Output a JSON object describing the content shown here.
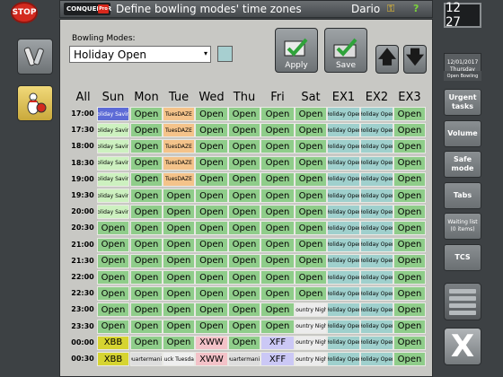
{
  "stop_button": "STOP",
  "titlebar": {
    "logo": "CONQUEROR",
    "logo_badge": "Pro",
    "title": "Define bowling modes' time zones",
    "user": "Dario",
    "key_icon": "key-icon",
    "help_icon": "?"
  },
  "form": {
    "bowling_modes_label": "Bowling Modes:",
    "bowling_mode_value": "Holiday Open",
    "swatch_color": "#a7cfd0"
  },
  "toolbar": {
    "apply_label": "Apply",
    "save_label": "Save"
  },
  "grid": {
    "headers": [
      "All",
      "Sun",
      "Mon",
      "Tue",
      "Wed",
      "Thu",
      "Fri",
      "Sat",
      "EX1",
      "EX2",
      "EX3"
    ],
    "times": [
      "17:00",
      "17:30",
      "18:00",
      "18:30",
      "19:00",
      "19:30",
      "20:00",
      "20:30",
      "21:00",
      "21:30",
      "22:00",
      "22:30",
      "23:00",
      "23:30",
      "00:00",
      "00:30"
    ],
    "colors": {
      "o": "#8fcd8a",
      "hs": "#cdf1c0",
      "hs_sel": "#5d6bd6",
      "ho": "#9fd0cd",
      "t": "#f4c38a",
      "c": "#ececec",
      "q": "#dedede",
      "xbb": "#d6d431",
      "xww": "#f3c2c8",
      "xff": "#cbc8f5",
      "b": "#efefef"
    },
    "labels": {
      "o": "Open",
      "hs": "Holiday Saving",
      "ho": "Holiday Open",
      "t": "TuesDAZE",
      "c": "Country Night",
      "q": "Quartermania",
      "b": "Buck Tuesday",
      "xbb": "XBB",
      "xww": "XWW",
      "xff": "XFF"
    },
    "rows": [
      [
        "hs_sel",
        "o",
        "t",
        "o",
        "o",
        "o",
        "o",
        "ho",
        "ho",
        "o"
      ],
      [
        "hs",
        "o",
        "t",
        "o",
        "o",
        "o",
        "o",
        "ho",
        "ho",
        "o"
      ],
      [
        "hs",
        "o",
        "t",
        "o",
        "o",
        "o",
        "o",
        "ho",
        "ho",
        "o"
      ],
      [
        "hs",
        "o",
        "t",
        "o",
        "o",
        "o",
        "o",
        "ho",
        "ho",
        "o"
      ],
      [
        "hs",
        "o",
        "t",
        "o",
        "o",
        "o",
        "o",
        "ho",
        "ho",
        "o"
      ],
      [
        "hs",
        "o",
        "o",
        "o",
        "o",
        "o",
        "o",
        "ho",
        "ho",
        "o"
      ],
      [
        "hs",
        "o",
        "o",
        "o",
        "o",
        "o",
        "o",
        "ho",
        "ho",
        "o"
      ],
      [
        "o",
        "o",
        "o",
        "o",
        "o",
        "o",
        "o",
        "ho",
        "ho",
        "o"
      ],
      [
        "o",
        "o",
        "o",
        "o",
        "o",
        "o",
        "o",
        "ho",
        "ho",
        "o"
      ],
      [
        "o",
        "o",
        "o",
        "o",
        "o",
        "o",
        "o",
        "ho",
        "ho",
        "o"
      ],
      [
        "o",
        "o",
        "o",
        "o",
        "o",
        "o",
        "o",
        "ho",
        "ho",
        "o"
      ],
      [
        "o",
        "o",
        "o",
        "o",
        "o",
        "o",
        "o",
        "ho",
        "ho",
        "o"
      ],
      [
        "o",
        "o",
        "o",
        "o",
        "o",
        "o",
        "c",
        "ho",
        "ho",
        "o"
      ],
      [
        "o",
        "o",
        "o",
        "o",
        "o",
        "o",
        "c",
        "ho",
        "ho",
        "o"
      ],
      [
        "xbb",
        "o",
        "o",
        "xww",
        "o",
        "xff",
        "c",
        "ho",
        "ho",
        "o"
      ],
      [
        "xbb",
        "q",
        "b",
        "xww",
        "q",
        "xff",
        "c",
        "ho",
        "ho",
        "o"
      ]
    ]
  },
  "right_rail": {
    "clock": "12 27",
    "date": "12/01/2017",
    "weekday": "Thursday",
    "mode": "Open Bowling",
    "buttons": [
      "Urgent tasks",
      "Volume",
      "Safe mode",
      "Tabs",
      "Waiting list (0 items)",
      "TCS"
    ],
    "close_label": "X"
  }
}
